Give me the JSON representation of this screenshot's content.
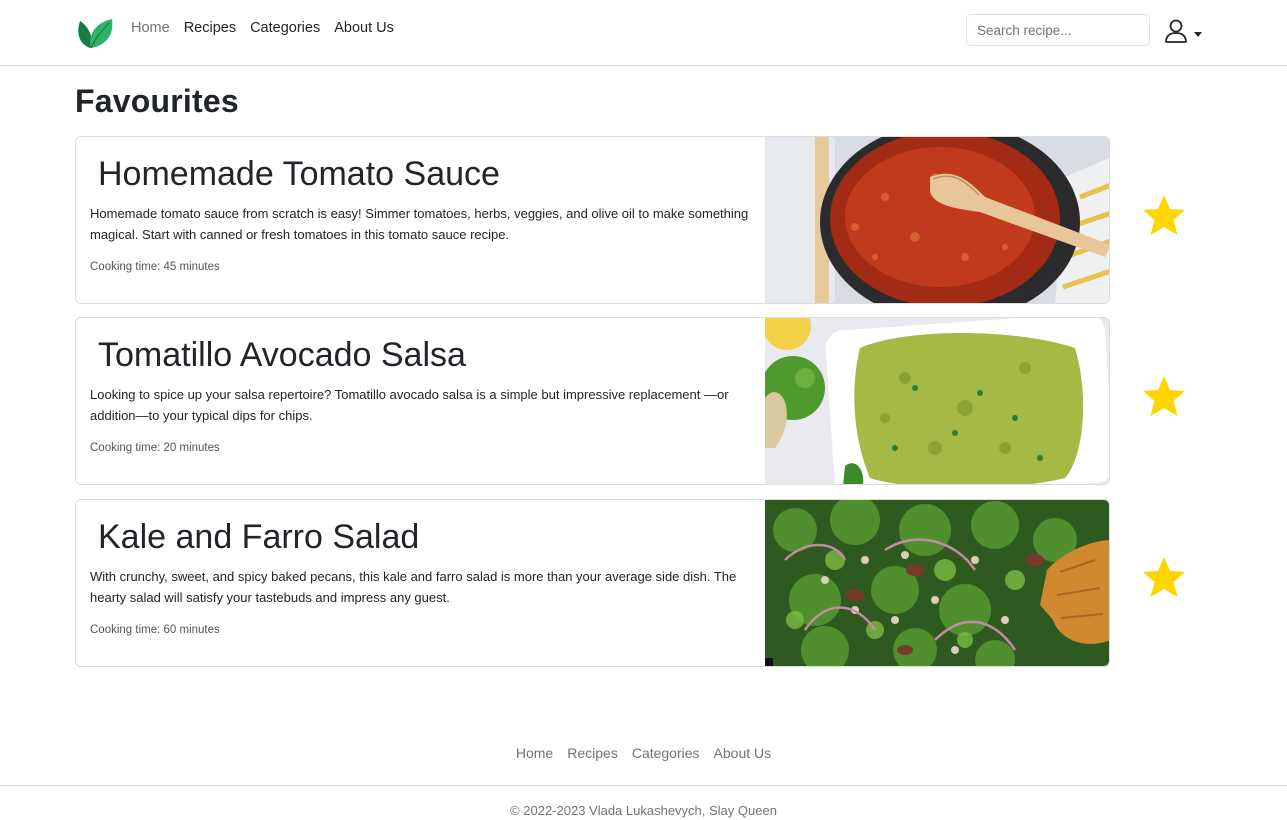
{
  "nav": {
    "links": [
      "Home",
      "Recipes",
      "Categories",
      "About Us"
    ],
    "search_placeholder": "Search recipe..."
  },
  "page_title": "Favourites",
  "recipes": [
    {
      "title": "Homemade Tomato Sauce",
      "description": "Homemade tomato sauce from scratch is easy! Simmer tomatoes, herbs, veggies, and olive oil to make something magical. Start with canned or fresh tomatoes in this tomato sauce recipe.",
      "cooking_time": "Cooking time: 45 minutes",
      "favourite": true
    },
    {
      "title": "Tomatillo Avocado Salsa",
      "description": "Looking to spice up your salsa repertoire? Tomatillo avocado salsa is a simple but impressive replacement —or addition—to your typical dips for chips.",
      "cooking_time": "Cooking time: 20 minutes",
      "favourite": true
    },
    {
      "title": "Kale and Farro Salad",
      "description": "With crunchy, sweet, and spicy baked pecans, this kale and farro salad is more than your average side dish. The hearty salad will satisfy your tastebuds and impress any guest.",
      "cooking_time": "Cooking time: 60 minutes",
      "favourite": true
    }
  ],
  "footer": {
    "links": [
      "Home",
      "Recipes",
      "Categories",
      "About Us"
    ],
    "copyright": "© 2022-2023 Vlada Lukashevych, Slay Queen"
  },
  "colors": {
    "star": "#ffd500",
    "logo_dark": "#1b7a44",
    "logo_light": "#2fb36a"
  }
}
